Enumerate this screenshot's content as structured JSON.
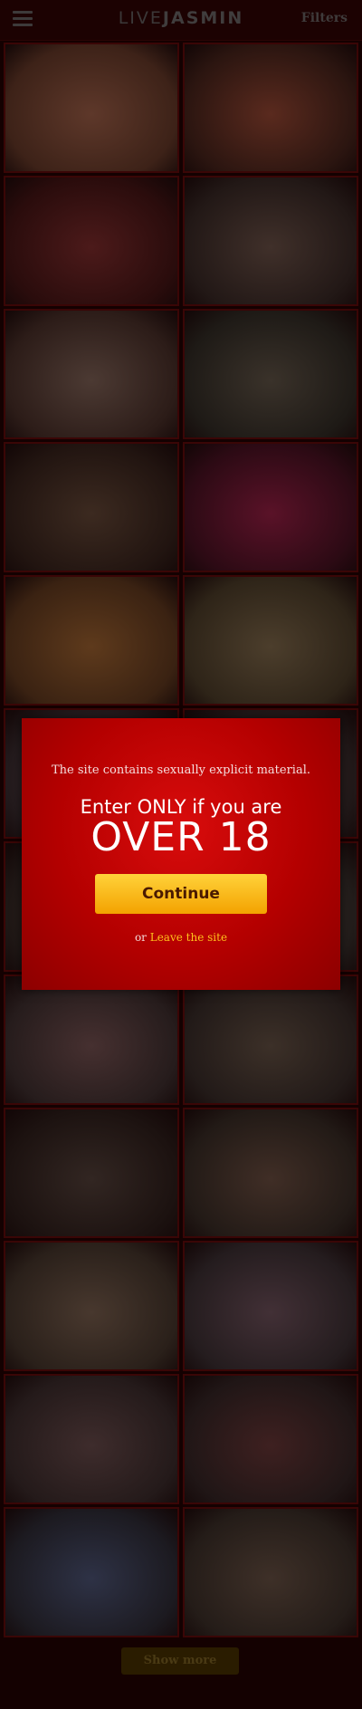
{
  "header": {
    "logo_light": "LIVE",
    "logo_bold": "JASMIN",
    "filters_label": "Filters"
  },
  "grid": {
    "tiles": [
      {
        "color": "#3d2218",
        "accent": "#5e382a"
      },
      {
        "color": "#2b1510",
        "accent": "#5a2a1e"
      },
      {
        "color": "#2a0c0c",
        "accent": "#4c1a1a"
      },
      {
        "color": "#221816",
        "accent": "#40302a"
      },
      {
        "color": "#2c1c18",
        "accent": "#4c3a33"
      },
      {
        "color": "#1e1a16",
        "accent": "#3a322a"
      },
      {
        "color": "#211410",
        "accent": "#3c2a20"
      },
      {
        "color": "#2c0a14",
        "accent": "#5a1228"
      },
      {
        "color": "#3a2212",
        "accent": "#5e3a1c"
      },
      {
        "color": "#2e2418",
        "accent": "#4c3e2c"
      },
      {
        "color": "#231a1c",
        "accent": "#3e3034"
      },
      {
        "color": "#211818",
        "accent": "#382c2a"
      },
      {
        "color": "#1f1715",
        "accent": "#362a24"
      },
      {
        "color": "#221c1a",
        "accent": "#3a302a"
      },
      {
        "color": "#261c1c",
        "accent": "#463030"
      },
      {
        "color": "#221a18",
        "accent": "#3c3028"
      },
      {
        "color": "#1c1210",
        "accent": "#322622"
      },
      {
        "color": "#221a16",
        "accent": "#402e26"
      },
      {
        "color": "#2a201a",
        "accent": "#48382e"
      },
      {
        "color": "#241c1e",
        "accent": "#423036"
      },
      {
        "color": "#241a1a",
        "accent": "#3e2c2c"
      },
      {
        "color": "#201616",
        "accent": "#3e2020"
      },
      {
        "color": "#1c1a20",
        "accent": "#2e3246"
      },
      {
        "color": "#241c18",
        "accent": "#3e3028"
      }
    ]
  },
  "footer": {
    "show_more_label": "Show more"
  },
  "modal": {
    "notice": "The site contains sexually explicit material.",
    "enter_line": "Enter ONLY if you are",
    "age_line": "OVER 18",
    "continue_label": "Continue",
    "or_text": "or",
    "leave_label": "Leave the site",
    "colors": {
      "background": "#c00000",
      "button": "#f7b41a",
      "link": "#ffc21c"
    }
  }
}
